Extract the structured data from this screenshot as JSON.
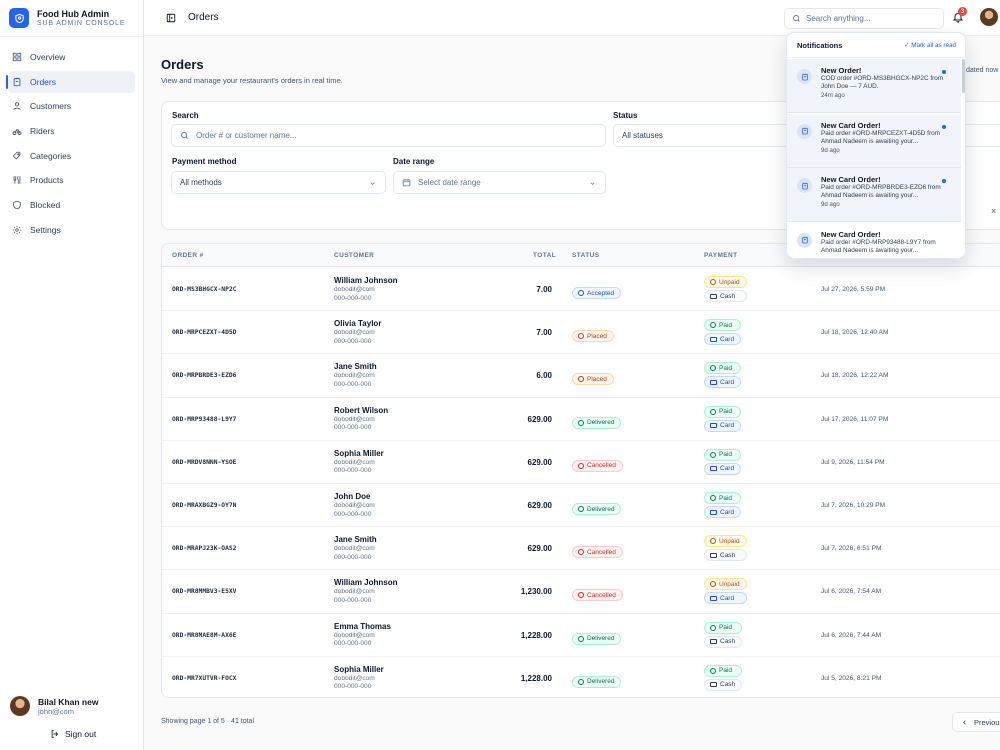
{
  "brand": {
    "title": "Food Hub Admin",
    "subtitle": "SUB ADMIN CONSOLE"
  },
  "nav": [
    {
      "label": "Overview",
      "icon": "grid-icon"
    },
    {
      "label": "Orders",
      "icon": "clipboard-icon",
      "active": true
    },
    {
      "label": "Customers",
      "icon": "user-icon"
    },
    {
      "label": "Riders",
      "icon": "bike-icon"
    },
    {
      "label": "Categories",
      "icon": "tag-icon"
    },
    {
      "label": "Products",
      "icon": "utensils-icon"
    },
    {
      "label": "Blocked",
      "icon": "shield-icon"
    },
    {
      "label": "Settings",
      "icon": "gear-icon"
    }
  ],
  "sidebar_user": {
    "name": "Bilal Khan new",
    "email": "john@com",
    "signout": "Sign out"
  },
  "topbar": {
    "title": "Orders",
    "search_placeholder": "Search anything...",
    "notif_count": "3"
  },
  "page": {
    "title": "Orders",
    "subtitle": "View and manage your restaurant's orders in real time.",
    "updated": "dated now"
  },
  "filters": {
    "search_label": "Search",
    "search_placeholder": "Order # or customer name...",
    "status_label": "Status",
    "status_value": "All statuses",
    "payment_label": "Payment method",
    "payment_value": "All methods",
    "date_label": "Date range",
    "date_placeholder": "Select date range",
    "close": "×"
  },
  "table": {
    "headers": {
      "order": "ORDER #",
      "customer": "CUSTOMER",
      "total": "TOTAL",
      "status": "STATUS",
      "payment": "PAYMENT"
    },
    "rows": [
      {
        "id": "ORD-MS3BHGCX-NP2C",
        "name": "William Johnson",
        "email": "dobodit@com",
        "phone": "000-000-000",
        "total": "7.00",
        "status": "Accepted",
        "status_class": "st-accepted",
        "pay_state": "Unpaid",
        "pay_method": "Cash",
        "date": "Jul 27, 2026, 5:59 PM"
      },
      {
        "id": "ORD-MRPCEZXT-4D5D",
        "name": "Olivia Taylor",
        "email": "dobodit@com",
        "phone": "000-000-000",
        "total": "7.00",
        "status": "Placed",
        "status_class": "st-placed",
        "pay_state": "Paid",
        "pay_method": "Card",
        "date": "Jul 18, 2026, 12:40 AM"
      },
      {
        "id": "ORD-MRPBRDE3-EZD6",
        "name": "Jane Smith",
        "email": "dobodit@com",
        "phone": "000-000-000",
        "total": "6.00",
        "status": "Placed",
        "status_class": "st-placed",
        "pay_state": "Paid",
        "pay_method": "Card",
        "date": "Jul 18, 2026, 12:22 AM"
      },
      {
        "id": "ORD-MRP93488-L9Y7",
        "name": "Robert Wilson",
        "email": "dobodit@com",
        "phone": "000-000-000",
        "total": "629.00",
        "status": "Delivered",
        "status_class": "st-delivered",
        "pay_state": "Paid",
        "pay_method": "Card",
        "date": "Jul 17, 2026, 11:07 PM"
      },
      {
        "id": "ORD-MRDV8NNN-YSOE",
        "name": "Sophia Miller",
        "email": "dobodit@com",
        "phone": "000-000-000",
        "total": "629.00",
        "status": "Cancelled",
        "status_class": "st-cancelled",
        "pay_state": "Paid",
        "pay_method": "Card",
        "date": "Jul 9, 2026, 11:54 PM"
      },
      {
        "id": "ORD-MRAXBGZ9-OY7N",
        "name": "John Doe",
        "email": "dobodit@com",
        "phone": "000-000-000",
        "total": "629.00",
        "status": "Delivered",
        "status_class": "st-delivered",
        "pay_state": "Paid",
        "pay_method": "Card",
        "date": "Jul 7, 2026, 10:29 PM"
      },
      {
        "id": "ORD-MRAPJ23K-OAS2",
        "name": "Jane Smith",
        "email": "dobodit@com",
        "phone": "000-000-000",
        "total": "629.00",
        "status": "Cancelled",
        "status_class": "st-cancelled",
        "pay_state": "Unpaid",
        "pay_method": "Cash",
        "date": "Jul 7, 2026, 6:51 PM"
      },
      {
        "id": "ORD-MR8MMBV3-E5XV",
        "name": "William Johnson",
        "email": "dobodit@com",
        "phone": "000-000-000",
        "total": "1,230.00",
        "status": "Cancelled",
        "status_class": "st-cancelled",
        "pay_state": "Unpaid",
        "pay_method": "Card",
        "date": "Jul 6, 2026, 7:54 AM"
      },
      {
        "id": "ORD-MR8MAE8M-AX6E",
        "name": "Emma Thomas",
        "email": "dobodit@com",
        "phone": "000-000-000",
        "total": "1,228.00",
        "status": "Delivered",
        "status_class": "st-delivered",
        "pay_state": "Paid",
        "pay_method": "Cash",
        "date": "Jul 6, 2026, 7:44 AM"
      },
      {
        "id": "ORD-MR7XUTVR-FOCX",
        "name": "Sophia Miller",
        "email": "dobodit@com",
        "phone": "000-000-000",
        "total": "1,228.00",
        "status": "Delivered",
        "status_class": "st-delivered",
        "pay_state": "Paid",
        "pay_method": "Cash",
        "date": "Jul 5, 2026, 8:21 PM"
      }
    ]
  },
  "footer": {
    "page_info": "Showing page 1 of 5 · 41 total",
    "previous": "Previous"
  },
  "notifications": {
    "title": "Notifications",
    "mark_all": "Mark all as read",
    "items": [
      {
        "title": "New Order!",
        "body": "COD order #ORD-MS3BHGCX-NP2C from John Doe — 7 AUD.",
        "time": "24m ago",
        "unread": true
      },
      {
        "title": "New Card Order!",
        "body": "Paid order #ORD-MRPCEZXT-4D5D from Ahmad Nadeem is awaiting your...",
        "time": "9d ago",
        "unread": true
      },
      {
        "title": "New Card Order!",
        "body": "Paid order #ORD-MRPBRDE3-EZD6 from Ahmad Nadeem is awaiting your...",
        "time": "9d ago",
        "unread": true
      },
      {
        "title": "New Card Order!",
        "body": "Paid order #ORD-MRP93488-L9Y7 from Ahmad Nadeem is awaiting your...",
        "time": "",
        "unread": false
      }
    ]
  }
}
